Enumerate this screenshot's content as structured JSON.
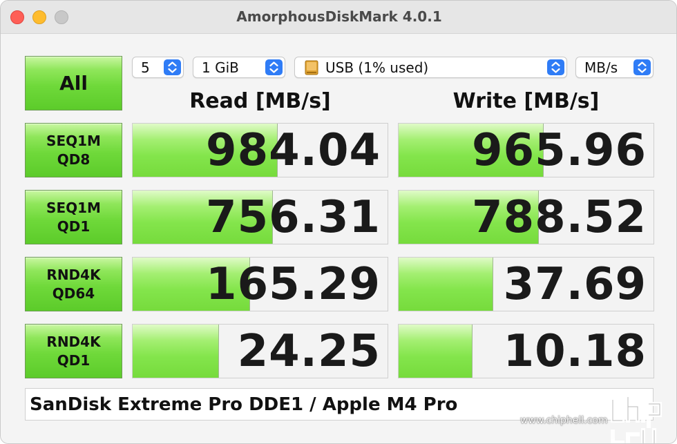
{
  "window": {
    "title": "AmorphousDiskMark 4.0.1"
  },
  "toolbar": {
    "all_label": "All",
    "count_value": "5",
    "size_value": "1 GiB",
    "drive_value": "USB (1% used)",
    "unit_value": "MB/s",
    "drive_icon": "external-drive-icon"
  },
  "headers": {
    "read": "Read [MB/s]",
    "write": "Write [MB/s]"
  },
  "tests": [
    {
      "line1": "SEQ1M",
      "line2": "QD8",
      "read": "984.04",
      "write": "965.96",
      "read_fill": 0.57,
      "write_fill": 0.57
    },
    {
      "line1": "SEQ1M",
      "line2": "QD1",
      "read": "756.31",
      "write": "788.52",
      "read_fill": 0.55,
      "write_fill": 0.55
    },
    {
      "line1": "RND4K",
      "line2": "QD64",
      "read": "165.29",
      "write": "37.69",
      "read_fill": 0.46,
      "write_fill": 0.37
    },
    {
      "line1": "RND4K",
      "line2": "QD1",
      "read": "24.25",
      "write": "10.18",
      "read_fill": 0.34,
      "write_fill": 0.29
    }
  ],
  "info": "SanDisk Extreme Pro DDE1 / Apple M4 Pro",
  "watermark": {
    "text": "www.chiphell.com"
  },
  "colors": {
    "accent_blue": "#2f7cf6",
    "bar_green": "#84e54c",
    "button_green": "#6fd93a"
  }
}
